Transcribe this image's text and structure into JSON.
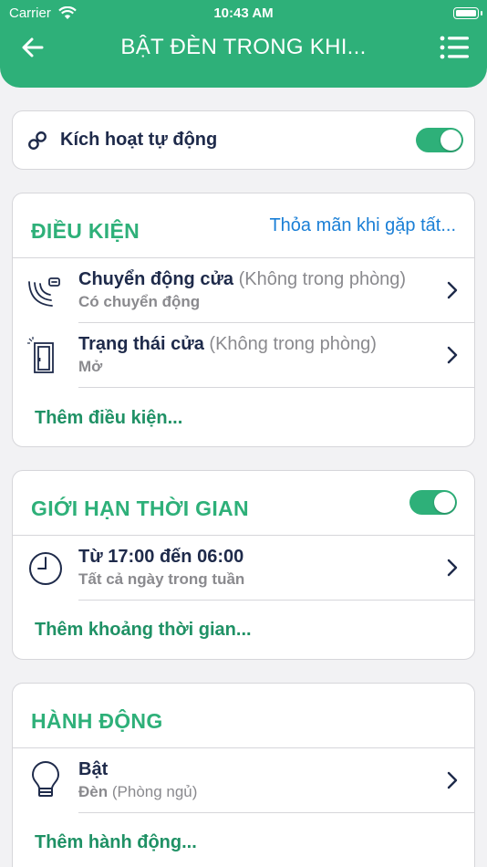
{
  "status_bar": {
    "carrier": "Carrier",
    "time": "10:43 AM"
  },
  "header": {
    "title": "BẬT ĐÈN TRONG KHI..."
  },
  "auto": {
    "label": "Kích hoạt tự động",
    "enabled": true
  },
  "conditions": {
    "title": "ĐIỀU KIỆN",
    "match_link": "Thỏa mãn khi gặp tất...",
    "items": [
      {
        "name": "Chuyển động cửa",
        "room": "(Không trong phòng)",
        "state": "Có chuyển động",
        "icon": "motion-sensor-icon"
      },
      {
        "name": "Trạng thái cửa",
        "room": "(Không trong phòng)",
        "state": "Mở",
        "icon": "door-icon"
      }
    ],
    "add_label": "Thêm điều kiện..."
  },
  "time_limit": {
    "title": "GIỚI HẠN THỜI GIAN",
    "enabled": true,
    "items": [
      {
        "range": "Từ 17:00 đến 06:00",
        "days": "Tất cả ngày trong tuần",
        "icon": "clock-icon"
      }
    ],
    "add_label": "Thêm khoảng thời gian..."
  },
  "actions": {
    "title": "HÀNH ĐỘNG",
    "items": [
      {
        "action": "Bật",
        "device": "Đèn",
        "room": "(Phòng ngủ)",
        "icon": "light-bulb-icon"
      }
    ],
    "add_label": "Thêm hành động..."
  },
  "colors": {
    "accent": "#2eb079",
    "link": "#1a7fd6",
    "text": "#1e2a4a",
    "secondary": "#8a8a8e"
  }
}
